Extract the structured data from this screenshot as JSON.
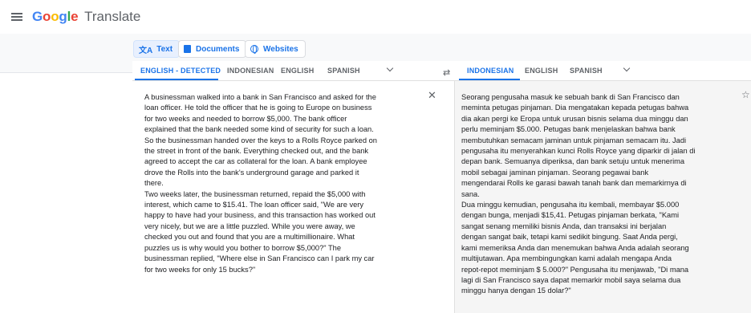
{
  "app": {
    "logo": [
      "G",
      "o",
      "o",
      "g",
      "l",
      "e"
    ],
    "product": "Translate"
  },
  "modes": [
    {
      "label": "Text",
      "icon": "translate-icon"
    },
    {
      "label": "Documents",
      "icon": "document-icon"
    },
    {
      "label": "Websites",
      "icon": "globe-icon"
    }
  ],
  "source_langs": [
    "ENGLISH - DETECTED",
    "INDONESIAN",
    "ENGLISH",
    "SPANISH"
  ],
  "target_langs": [
    "INDONESIAN",
    "ENGLISH",
    "SPANISH"
  ],
  "icons": {
    "menu": "menu-icon",
    "swap": "swap-icon",
    "clear": "close-icon",
    "star": "star-icon",
    "chevron": "chevron-down-icon"
  },
  "source_text": "A businessman walked into a bank in San Francisco and asked for the\nloan officer. He told the officer that he is going to Europe on business\nfor two weeks and needed to borrow $5,000. The bank officer\nexplained that the bank needed some kind of security for such a loan.\nSo the businessman handed over the keys to a Rolls Royce parked on\nthe street in front of the bank. Everything checked out, and the bank\nagreed to accept the car as collateral for the loan. A bank employee\ndrove the Rolls into the bank's underground garage and parked it\nthere.\nTwo weeks later, the businessman returned, repaid the $5,000 with\ninterest, which came to $15.41. The loan officer said, \"We are very\nhappy to have had your business, and this transaction has worked out\nvery nicely, but we are a little puzzled. While you were away, we\nchecked you out and found that you are a multimillionaire. What\npuzzles us is why would you bother to borrow $5,000?\" The\nbusinessman replied, \"Where else in San Francisco can I park my car\nfor two weeks for only 15 bucks?\"",
  "target_text": "Seorang pengusaha masuk ke sebuah bank di San Francisco dan\nmeminta petugas pinjaman. Dia mengatakan kepada petugas bahwa\ndia akan pergi ke Eropa untuk urusan bisnis selama dua minggu dan\nperlu meminjam $5.000. Petugas bank menjelaskan bahwa bank\nmembutuhkan semacam jaminan untuk pinjaman semacam itu. Jadi\npengusaha itu menyerahkan kunci Rolls Royce yang diparkir di jalan di\ndepan bank. Semuanya diperiksa, dan bank setuju untuk menerima\nmobil sebagai jaminan pinjaman. Seorang pegawai bank\nmengendarai Rolls ke garasi bawah tanah bank dan memarkirnya di\nsana.\nDua minggu kemudian, pengusaha itu kembali, membayar $5.000\ndengan bunga, menjadi $15,41. Petugas pinjaman berkata, \"Kami\nsangat senang memiliki bisnis Anda, dan transaksi ini berjalan\ndengan sangat baik, tetapi kami sedikit bingung. Saat Anda pergi,\nkami memeriksa Anda dan menemukan bahwa Anda adalah seorang\nmultijutawan. Apa membingungkan kami adalah mengapa Anda\nrepot-repot meminjam $ 5.000?\" Pengusaha itu menjawab, \"Di mana\nlagi di San Francisco saya dapat memarkir mobil saya selama dua\nminggu hanya dengan 15 dolar?\""
}
